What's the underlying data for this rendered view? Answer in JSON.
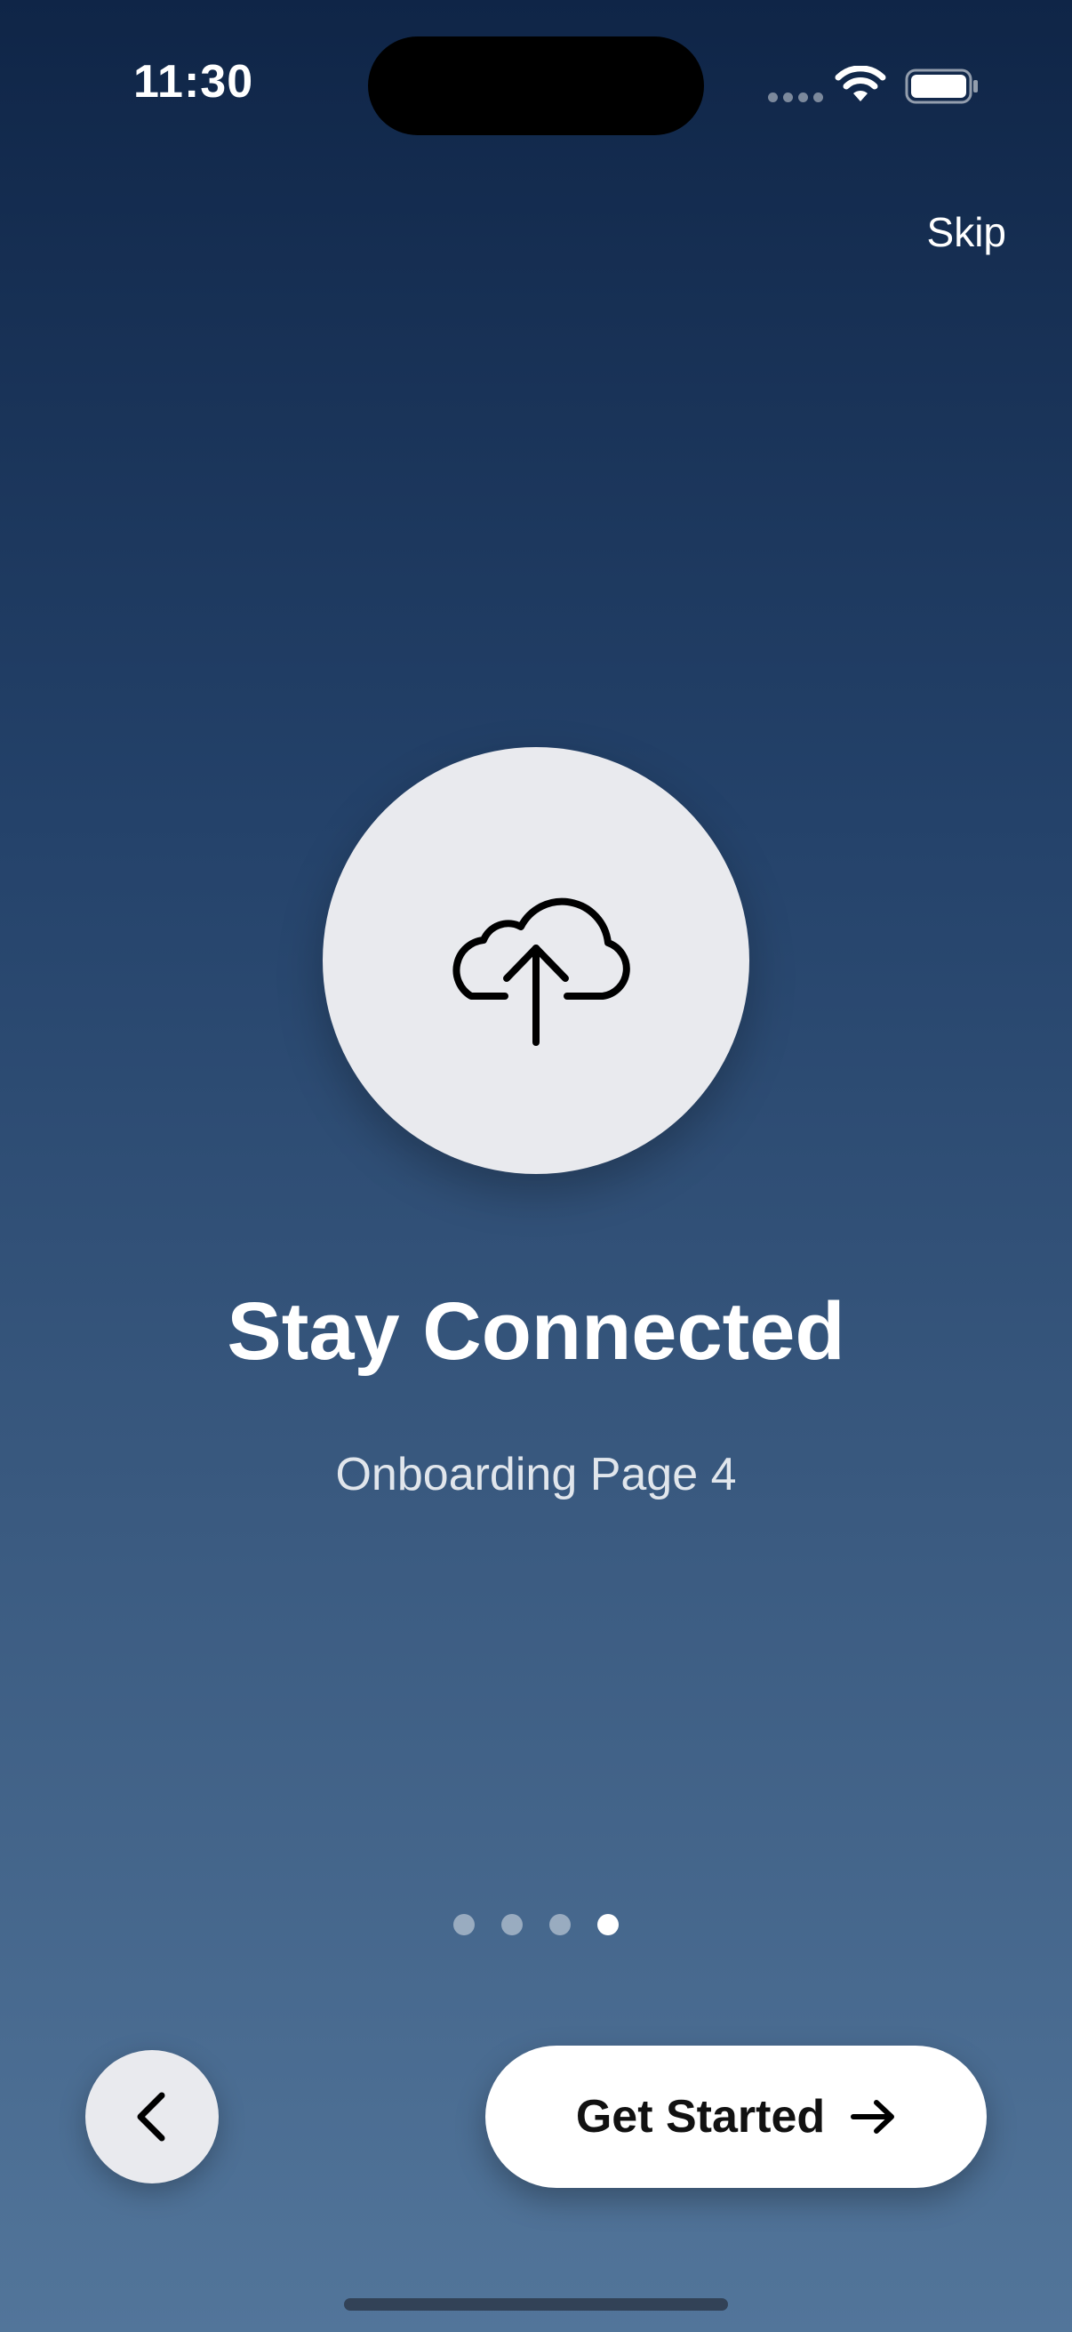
{
  "status_bar": {
    "time": "11:30",
    "icons": [
      "cellular-signal-icon",
      "wifi-icon",
      "battery-icon"
    ]
  },
  "header": {
    "skip_label": "Skip"
  },
  "hero": {
    "icon": "cloud-upload-icon",
    "title": "Stay Connected",
    "subtitle": "Onboarding Page 4"
  },
  "pagination": {
    "total": 4,
    "current": 4
  },
  "controls": {
    "back_icon": "chevron-left-icon",
    "primary_label": "Get Started",
    "primary_icon": "arrow-right-icon"
  },
  "colors": {
    "background_top": "#0f2547",
    "background_bottom": "#52759a",
    "circle": "#e9eaee",
    "button": "#ffffff"
  }
}
